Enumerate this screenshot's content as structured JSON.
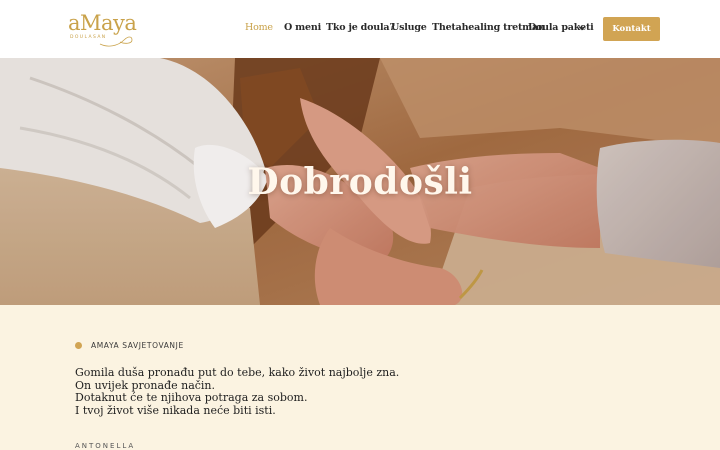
{
  "brand": {
    "logo_text": "aMaya",
    "logo_sub": "DOULASAN",
    "accent": "#d1a453"
  },
  "nav": {
    "items": [
      {
        "label": "Home",
        "active": true
      },
      {
        "label": "O meni"
      },
      {
        "label": "Tko je doula?"
      },
      {
        "label": "Usluge"
      },
      {
        "label": "Thetahealing tretman"
      },
      {
        "label": "Doula paketi",
        "has_dropdown": true
      }
    ],
    "cta_label": "Kontakt"
  },
  "hero": {
    "title": "Dobrodošli"
  },
  "intro": {
    "eyebrow": "AMAYA SAVJETOVANJE",
    "lines": [
      "Gomila duša pronađu put do tebe, kako život najbolje zna.",
      "On uvijek pronađe način.",
      "Dotaknut će te njihova potraga za sobom.",
      "I tvoj život više nikada neće biti isti."
    ],
    "author": "ANTONELLA"
  }
}
